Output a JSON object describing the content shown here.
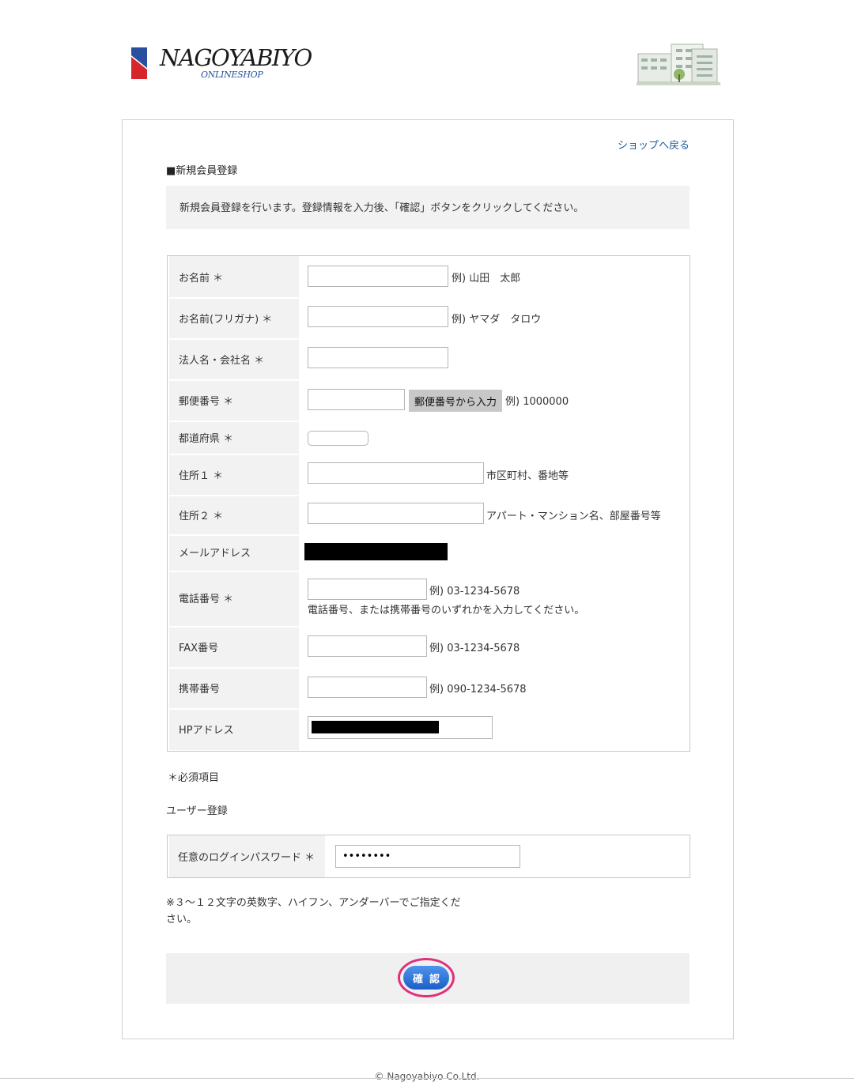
{
  "header": {
    "logo_text": "NAGOYABIYO",
    "logo_sub": "ONLINESHOP",
    "colors": {
      "logo_blue": "#2a4fa0",
      "logo_red": "#d7262b"
    }
  },
  "panel": {
    "back_link": "ショップへ戻る",
    "section_title": "■新規会員登録",
    "notice": "新規会員登録を行います。登録情報を入力後、「確認」ボタンをクリックしてください。"
  },
  "form": {
    "name": {
      "label": "お名前 ＊",
      "value": "",
      "hint": "例) 山田　太郎"
    },
    "kana": {
      "label": "お名前(フリガナ) ＊",
      "value": "",
      "hint": "例) ヤマダ　タロウ"
    },
    "company": {
      "label": "法人名・会社名 ＊",
      "value": ""
    },
    "zip": {
      "label": "郵便番号 ＊",
      "value": "",
      "button": "郵便番号から入力",
      "hint": "例) 1000000"
    },
    "pref": {
      "label": "都道府県 ＊",
      "value": ""
    },
    "addr1": {
      "label": "住所１ ＊",
      "value": "",
      "hint": "市区町村、番地等"
    },
    "addr2": {
      "label": "住所２ ＊",
      "value": "",
      "hint": "アパート・マンション名、部屋番号等"
    },
    "email": {
      "label": "メールアドレス"
    },
    "tel": {
      "label": "電話番号 ＊",
      "value": "",
      "hint": "例) 03-1234-5678",
      "note": "電話番号、または携帯番号のいずれかを入力してください。"
    },
    "fax": {
      "label": "FAX番号",
      "value": "",
      "hint": "例) 03-1234-5678"
    },
    "mobile": {
      "label": "携帯番号",
      "value": "",
      "hint": "例) 090-1234-5678"
    },
    "hp": {
      "label": "HPアドレス"
    }
  },
  "required_note": "＊必須項目",
  "user_reg": {
    "title": "ユーザー登録",
    "password_label": "任意のログインパスワード ＊",
    "password_value": "••••••••",
    "note": "※３〜１２文字の英数字、ハイフン、アンダーバーでご指定ください。"
  },
  "confirm_button": "確認",
  "footer": {
    "copyright": "© Nagoyabiyo Co.Ltd."
  },
  "colors": {
    "accent": "#1a5a9c",
    "button_blue": "#1b5ec7",
    "highlight_ring": "#e0307c",
    "label_bg": "#f2f2f2"
  }
}
